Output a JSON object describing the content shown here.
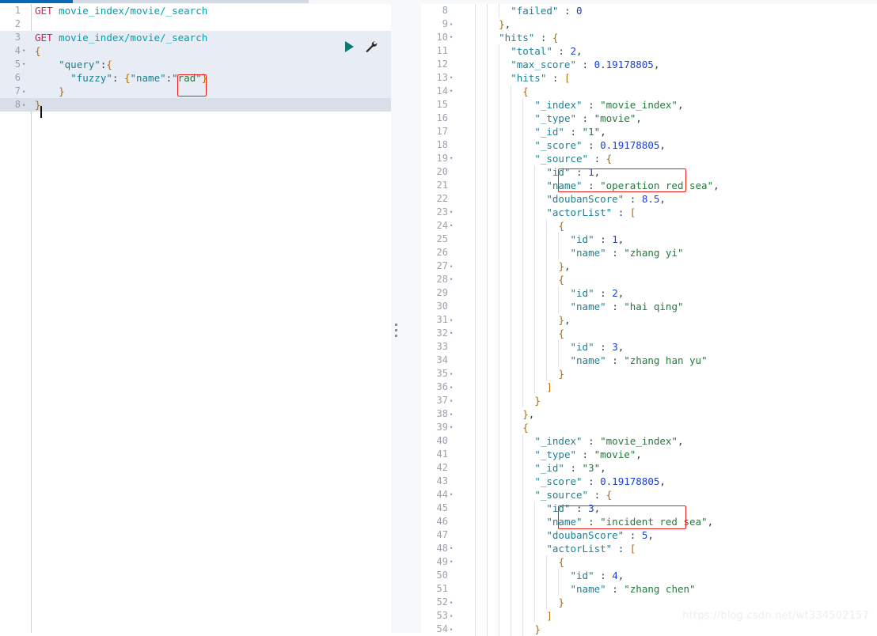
{
  "app": {
    "name": "Kibana Dev Tools Console",
    "accent_blue": "#0868b5",
    "accent_gray": "#d3d9e0",
    "annotation_color": "#ee1c1c"
  },
  "topbar": {
    "active_tab_label": "",
    "inactive_tab_label": ""
  },
  "actions": {
    "run_label": "play-triangle",
    "wrench_label": "wrench"
  },
  "request_editor": {
    "name": "request-editor",
    "first_line": 1,
    "lines": [
      {
        "n": 1,
        "fold": "",
        "text": "GET movie_index/movie/_search",
        "bg": ""
      },
      {
        "n": 2,
        "fold": "",
        "text": "",
        "bg": ""
      },
      {
        "n": 3,
        "fold": "",
        "text": "GET movie_index/movie/_search",
        "bg": "request"
      },
      {
        "n": 4,
        "fold": "▾",
        "text": "{",
        "bg": "request"
      },
      {
        "n": 5,
        "fold": "▾",
        "text": "    \"query\":{",
        "bg": "request"
      },
      {
        "n": 6,
        "fold": "",
        "text": "      \"fuzzy\": {\"name\":\"rad\"}",
        "bg": "request"
      },
      {
        "n": 7,
        "fold": "▴",
        "text": "    }",
        "bg": "request"
      },
      {
        "n": 8,
        "fold": "▴",
        "text": "}",
        "bg": "active"
      }
    ],
    "highlight": {
      "name": "fuzzy-value-highlight",
      "value": "\"rad\""
    }
  },
  "response_editor": {
    "name": "response-viewer",
    "first_line": 8,
    "lines": [
      {
        "n": 8,
        "fold": "",
        "text": "      \"failed\" : 0"
      },
      {
        "n": 9,
        "fold": "▴",
        "text": "    },"
      },
      {
        "n": 10,
        "fold": "▾",
        "text": "    \"hits\" : {"
      },
      {
        "n": 11,
        "fold": "",
        "text": "      \"total\" : 2,"
      },
      {
        "n": 12,
        "fold": "",
        "text": "      \"max_score\" : 0.19178805,"
      },
      {
        "n": 13,
        "fold": "▾",
        "text": "      \"hits\" : ["
      },
      {
        "n": 14,
        "fold": "▾",
        "text": "        {"
      },
      {
        "n": 15,
        "fold": "",
        "text": "          \"_index\" : \"movie_index\","
      },
      {
        "n": 16,
        "fold": "",
        "text": "          \"_type\" : \"movie\","
      },
      {
        "n": 17,
        "fold": "",
        "text": "          \"_id\" : \"1\","
      },
      {
        "n": 18,
        "fold": "",
        "text": "          \"_score\" : 0.19178805,"
      },
      {
        "n": 19,
        "fold": "▾",
        "text": "          \"_source\" : {"
      },
      {
        "n": 20,
        "fold": "",
        "text": "            \"id\" : 1,"
      },
      {
        "n": 21,
        "fold": "",
        "text": "            \"name\" : \"operation red sea\","
      },
      {
        "n": 22,
        "fold": "",
        "text": "            \"doubanScore\" : 8.5,"
      },
      {
        "n": 23,
        "fold": "▾",
        "text": "            \"actorList\" : ["
      },
      {
        "n": 24,
        "fold": "▾",
        "text": "              {"
      },
      {
        "n": 25,
        "fold": "",
        "text": "                \"id\" : 1,"
      },
      {
        "n": 26,
        "fold": "",
        "text": "                \"name\" : \"zhang yi\""
      },
      {
        "n": 27,
        "fold": "▴",
        "text": "              },"
      },
      {
        "n": 28,
        "fold": "▾",
        "text": "              {"
      },
      {
        "n": 29,
        "fold": "",
        "text": "                \"id\" : 2,"
      },
      {
        "n": 30,
        "fold": "",
        "text": "                \"name\" : \"hai qing\""
      },
      {
        "n": 31,
        "fold": "▴",
        "text": "              },"
      },
      {
        "n": 32,
        "fold": "▾",
        "text": "              {"
      },
      {
        "n": 33,
        "fold": "",
        "text": "                \"id\" : 3,"
      },
      {
        "n": 34,
        "fold": "",
        "text": "                \"name\" : \"zhang han yu\""
      },
      {
        "n": 35,
        "fold": "▴",
        "text": "              }"
      },
      {
        "n": 36,
        "fold": "▴",
        "text": "            ]"
      },
      {
        "n": 37,
        "fold": "▴",
        "text": "          }"
      },
      {
        "n": 38,
        "fold": "▴",
        "text": "        },"
      },
      {
        "n": 39,
        "fold": "▾",
        "text": "        {"
      },
      {
        "n": 40,
        "fold": "",
        "text": "          \"_index\" : \"movie_index\","
      },
      {
        "n": 41,
        "fold": "",
        "text": "          \"_type\" : \"movie\","
      },
      {
        "n": 42,
        "fold": "",
        "text": "          \"_id\" : \"3\","
      },
      {
        "n": 43,
        "fold": "",
        "text": "          \"_score\" : 0.19178805,"
      },
      {
        "n": 44,
        "fold": "▾",
        "text": "          \"_source\" : {"
      },
      {
        "n": 45,
        "fold": "",
        "text": "            \"id\" : 3,"
      },
      {
        "n": 46,
        "fold": "",
        "text": "            \"name\" : \"incident red sea\","
      },
      {
        "n": 47,
        "fold": "",
        "text": "            \"doubanScore\" : 5,"
      },
      {
        "n": 48,
        "fold": "▾",
        "text": "            \"actorList\" : ["
      },
      {
        "n": 49,
        "fold": "▾",
        "text": "              {"
      },
      {
        "n": 50,
        "fold": "",
        "text": "                \"id\" : 4,"
      },
      {
        "n": 51,
        "fold": "",
        "text": "                \"name\" : \"zhang chen\""
      },
      {
        "n": 52,
        "fold": "▴",
        "text": "              }"
      },
      {
        "n": 53,
        "fold": "▴",
        "text": "            ]"
      },
      {
        "n": 54,
        "fold": "▴",
        "text": "          }"
      }
    ],
    "highlights": [
      {
        "name": "hit-1-name-highlight",
        "value": "\"operation red sea\","
      },
      {
        "name": "hit-2-name-highlight",
        "value": "\"incident red sea\","
      }
    ]
  },
  "response_data": {
    "shards_failed": 0,
    "hits": {
      "total": 2,
      "max_score": 0.19178805,
      "hits": [
        {
          "_index": "movie_index",
          "_type": "movie",
          "_id": "1",
          "_score": 0.19178805,
          "_source": {
            "id": 1,
            "name": "operation red sea",
            "doubanScore": 8.5,
            "actorList": [
              {
                "id": 1,
                "name": "zhang yi"
              },
              {
                "id": 2,
                "name": "hai qing"
              },
              {
                "id": 3,
                "name": "zhang han yu"
              }
            ]
          }
        },
        {
          "_index": "movie_index",
          "_type": "movie",
          "_id": "3",
          "_score": 0.19178805,
          "_source": {
            "id": 3,
            "name": "incident red sea",
            "doubanScore": 5,
            "actorList": [
              {
                "id": 4,
                "name": "zhang chen"
              }
            ]
          }
        }
      ]
    }
  },
  "watermark": {
    "text": "https://blog.csdn.net/wt334502157"
  }
}
